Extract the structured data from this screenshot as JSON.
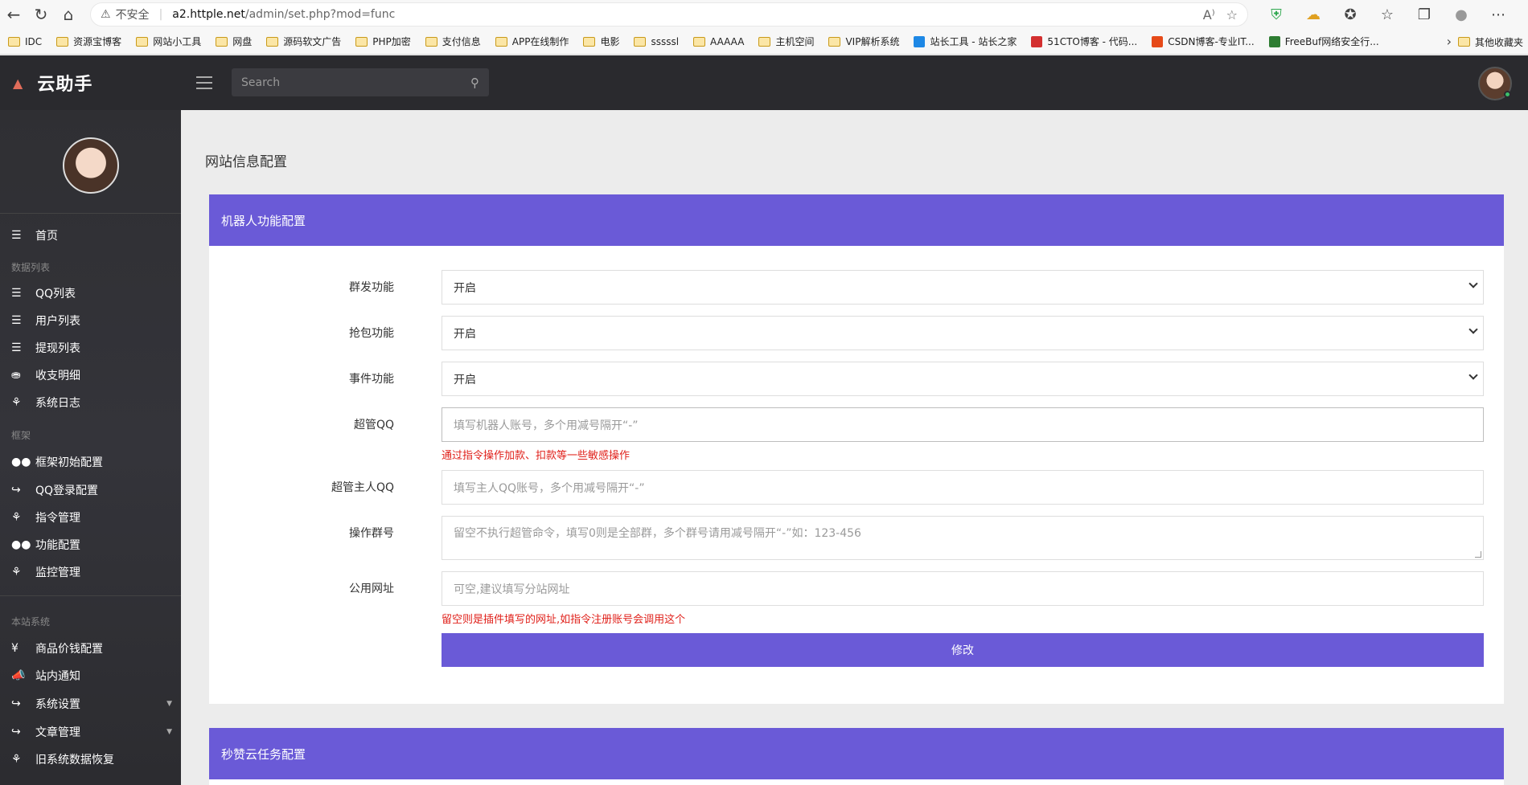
{
  "browser": {
    "security_label": "不安全",
    "url_domain": "a2.httple.net",
    "url_path": "/admin/set.php?mod=func",
    "bookmarks": [
      "IDC",
      "资源宝博客",
      "网站小工具",
      "网盘",
      "源码软文广告",
      "PHP加密",
      "支付信息",
      "APP在线制作",
      "电影",
      "sssssl",
      "AAAAA",
      "主机空间",
      "VIP解析系统",
      "站长工具 - 站长之家",
      "51CTO博客 - 代码...",
      "CSDN博客-专业IT...",
      "FreeBuf网络安全行..."
    ],
    "other_bookmarks": "其他收藏夹"
  },
  "header": {
    "app_name": "云助手",
    "search_placeholder": "Search"
  },
  "sidebar": {
    "home": "首页",
    "section_data": "数据列表",
    "qq_list": "QQ列表",
    "user_list": "用户列表",
    "withdraw_list": "提现列表",
    "income_detail": "收支明细",
    "system_log": "系统日志",
    "section_frame": "框架",
    "frame_init": "框架初始配置",
    "qq_login": "QQ登录配置",
    "command_mgmt": "指令管理",
    "func_config": "功能配置",
    "monitor_mgmt": "监控管理",
    "section_site": "本站系统",
    "price_config": "商品价钱配置",
    "site_notice": "站内通知",
    "system_settings": "系统设置",
    "article_mgmt": "文章管理",
    "old_restore": "旧系统数据恢复"
  },
  "main": {
    "page_title": "网站信息配置",
    "panel1_title": "机器人功能配置",
    "mass_send_label": "群发功能",
    "mass_send_value": "开启",
    "grab_label": "抢包功能",
    "grab_value": "开启",
    "event_label": "事件功能",
    "event_value": "开启",
    "admin_qq_label": "超管QQ",
    "admin_qq_placeholder": "填写机器人账号，多个用减号隔开“-”",
    "admin_qq_hint": "通过指令操作加款、扣款等一些敏感操作",
    "owner_qq_label": "超管主人QQ",
    "owner_qq_placeholder": "填写主人QQ账号，多个用减号隔开“-”",
    "op_group_label": "操作群号",
    "op_group_placeholder": "留空不执行超管命令，填写0则是全部群，多个群号请用减号隔开“-”如：123-456",
    "public_url_label": "公用网址",
    "public_url_placeholder": "可空,建议填写分站网址",
    "public_url_hint": "留空则是插件填写的网址,如指令注册账号会调用这个",
    "submit_label": "修改",
    "panel2_title": "秒赞云任务配置"
  }
}
